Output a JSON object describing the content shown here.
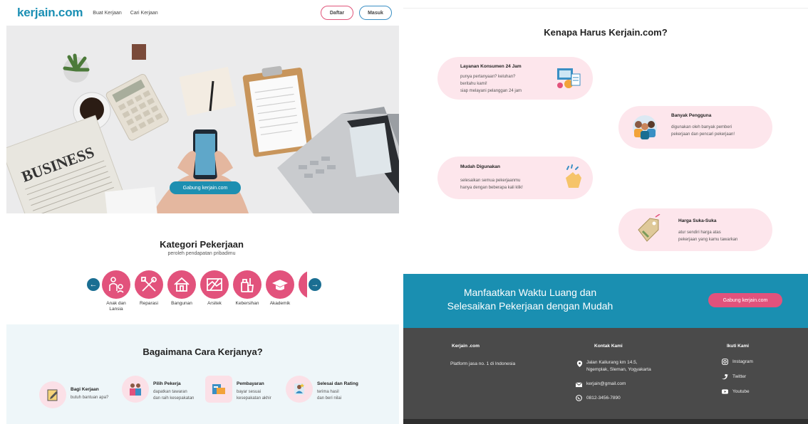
{
  "nav": {
    "logo": "kerjain.com",
    "links": [
      "Buat Kerjaan",
      "Cari Kerjaan"
    ],
    "daftar": "Daftar",
    "masuk": "Masuk"
  },
  "hero": {
    "cta": "Gabung kerjain.com"
  },
  "kategori": {
    "title": "Kategori Pekerjaan",
    "subtitle": "peroleh pendapatan pribadimu",
    "items": [
      "Anak dan Lansia",
      "Reparasi",
      "Bangunan",
      "Arsitek",
      "Kebersihan",
      "Akademik"
    ]
  },
  "cara": {
    "title": "Bagaimana Cara Kerjanya?",
    "steps": [
      {
        "title": "Bagi Kerjaan",
        "desc": "butuh bantuan apa?"
      },
      {
        "title": "Pilih Pekerja",
        "desc1": "dapatkan tawaran",
        "desc2": "dan raih kesepakatan"
      },
      {
        "title": "Pembayaran",
        "desc1": "bayar sesuai",
        "desc2": "kesepakatan akhir"
      },
      {
        "title": "Selesai dan Rating",
        "desc1": "terima hasil",
        "desc2": "dan beri nilai"
      }
    ]
  },
  "why": {
    "title": "Kenapa Harus Kerjain.com?",
    "features": [
      {
        "title": "Layanan Konsumen 24 Jam",
        "l1": "punya pertanyaan? keluhan?",
        "l2": "beritahu kami!",
        "l3": "siap melayani pelanggan 24 jam"
      },
      {
        "title": "Banyak Pengguna",
        "l1": "digunakan oleh banyak pemberi",
        "l2": "pekerjaan dan pencari pekerjaan!"
      },
      {
        "title": "Mudah Digunakan",
        "l1": "selesaikan semua pekerjaanmu",
        "l2": "hanya dengan beberapa kali klik!"
      },
      {
        "title": "Harga Suka-Suka",
        "l1": "atur sendiri harga atas",
        "l2": "pekerjaan yang kamu tawarkan"
      }
    ]
  },
  "cta": {
    "line1": "Manfaatkan Waktu Luang dan",
    "line2": "Selesaikan Pekerjaan dengan Mudah",
    "button": "Gabung kerjain.com"
  },
  "footer": {
    "about_title": "Kerjain .com",
    "about_text": "Platform jasa no. 1 di Indonesia",
    "contact_title": "Kontak Kami",
    "address1": "Jalan Kaliurang km 14.5,",
    "address2": "Ngemplak, Sleman, Yogyakarta",
    "email": "kerjain@gmail.com",
    "phone": "0812-3456-7890",
    "follow_title": "Ikuti Kami",
    "social": [
      "Instagram",
      "Twitter",
      "Youtube"
    ]
  },
  "colors": {
    "brand": "#1a8fb1",
    "accent": "#e2527c",
    "soft_pink": "#fde6ec",
    "footer": "#4a4a4a"
  }
}
